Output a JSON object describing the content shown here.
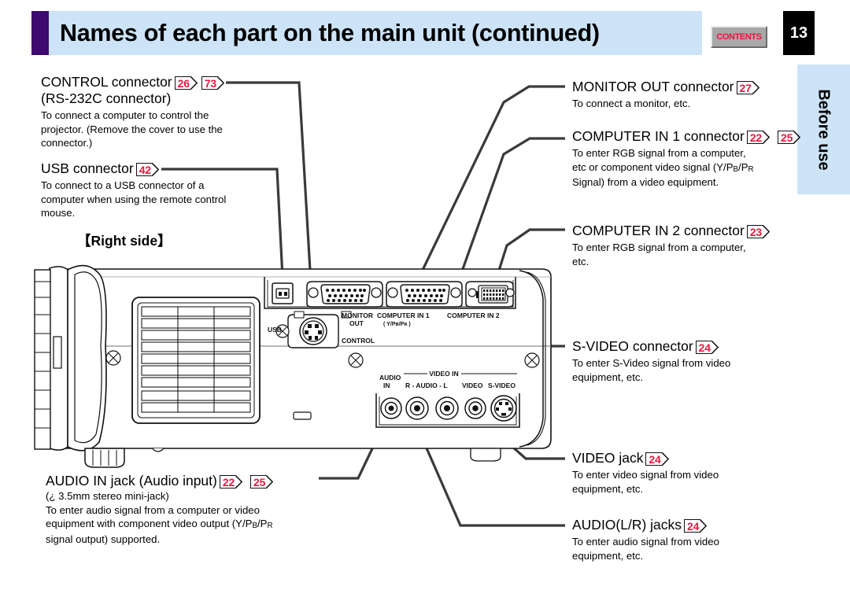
{
  "header": {
    "title": "Names of each part on the main unit (continued)",
    "contents_button": "CONTENTS",
    "page_number": "13",
    "accent_color": "#3d0a6e",
    "band_color": "#cde3f7"
  },
  "side_tab": {
    "label": "Before use",
    "color": "#cde3f7"
  },
  "section_label": "【Right side】",
  "badge_color": "#e8173f",
  "annotations": {
    "control": {
      "title": "CONTROL connector",
      "badges": [
        "26",
        "73"
      ],
      "subtitle": "(RS-232C connector)",
      "body": "To connect a computer to control the projector. (Remove the cover to use the connector.)"
    },
    "usb": {
      "title": "USB connector",
      "badges": [
        "42"
      ],
      "body": "To connect to a USB connector of a computer when using the remote control mouse."
    },
    "monitor_out": {
      "title": "MONITOR OUT connector",
      "badges": [
        "27"
      ],
      "body": "To connect a monitor, etc."
    },
    "computer_in_1": {
      "title": "COMPUTER IN 1 connector",
      "badges": [
        "22",
        "25"
      ],
      "body_line1": "To enter RGB signal from a computer,",
      "body_line2_a": "etc or component video signal (Y/P",
      "body_line2_b": "B",
      "body_line2_c": "/P",
      "body_line2_d": "R",
      "body_line3": "Signal) from a video equipment."
    },
    "computer_in_2": {
      "title": "COMPUTER IN 2 connector",
      "badges": [
        "23"
      ],
      "body": "To enter RGB signal from a computer, etc."
    },
    "s_video": {
      "title": "S-VIDEO connector",
      "badges": [
        "24"
      ],
      "body": "To enter S-Video signal from video equipment, etc."
    },
    "video": {
      "title": "VIDEO jack",
      "badges": [
        "24"
      ],
      "body": "To enter video signal from video equipment, etc."
    },
    "audio_lr": {
      "title": "AUDIO(L/R) jacks",
      "badges": [
        "24"
      ],
      "body": "To enter audio signal from video equipment, etc."
    },
    "audio_in": {
      "title": "AUDIO IN jack (Audio input)",
      "badges": [
        "22",
        "25"
      ],
      "subtitle": "(¿ 3.5mm stereo mini-jack)",
      "body_line1": "To enter audio signal from a computer or video",
      "body_line2_a": "equipment with component video output (Y/P",
      "body_line2_b": "B",
      "body_line2_c": "/P",
      "body_line2_d": "R",
      "body_line3": "signal output) supported."
    }
  },
  "panel_labels": {
    "usb": "USB",
    "monitor_out_line1": "MONITOR",
    "monitor_out_line2": "OUT",
    "control": "CONTROL",
    "computer_in_1": "COMPUTER IN 1",
    "computer_in_1_sub": "( Y/Pʙ/Pʀ )",
    "computer_in_2": "COMPUTER IN 2",
    "audio_in_line1": "AUDIO",
    "audio_in_line2": "IN",
    "video_in_group": "VIDEO IN",
    "r_audio_l": "R - AUDIO - L",
    "video": "VIDEO",
    "s_video": "S-VIDEO"
  }
}
